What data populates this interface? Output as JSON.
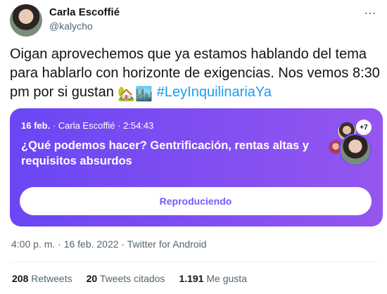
{
  "author": {
    "name": "Carla Escoffié",
    "handle": "@kalycho",
    "more_icon": "…"
  },
  "tweet": {
    "text": "Oigan aprovechemos que ya estamos hablando del tema para hablarlo con horizonte de exigencias. Nos vemos 8:30 pm por si gustan",
    "emoji": "🏡🏙️",
    "hashtag": "#LeyInquilinariaYa"
  },
  "space": {
    "date": "16 feb.",
    "separator1": " · ",
    "host": "Carla Escoffié",
    "separator2": " · ",
    "duration": "2:54:43",
    "title": "¿Qué podemos hacer? Gentrificación, rentas altas y requisitos absurdos",
    "extra_count": "+7",
    "play_label": "Reproduciendo",
    "colors": {
      "start": "#6a46f4",
      "end": "#9556ef",
      "button_text": "#7856ff"
    }
  },
  "meta": {
    "timestamp": "4:00 p. m. · 16 feb. 2022 · Twitter for Android"
  },
  "stats": [
    {
      "count": "208",
      "label": "Retweets"
    },
    {
      "count": "20",
      "label": "Tweets citados"
    },
    {
      "count": "1.191",
      "label": "Me gusta"
    }
  ]
}
